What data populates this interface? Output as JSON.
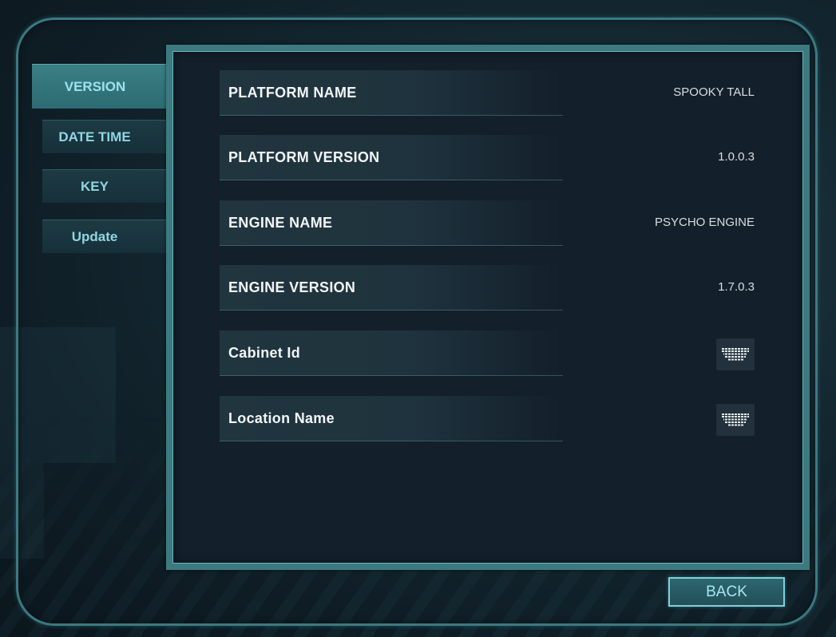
{
  "tabs": [
    {
      "label": "VERSION",
      "active": true
    },
    {
      "label": "DATE TIME",
      "active": false
    },
    {
      "label": "KEY",
      "active": false
    },
    {
      "label": "Update",
      "active": false
    }
  ],
  "rows": [
    {
      "label": "PLATFORM NAME",
      "value": "SPOOKY TALL"
    },
    {
      "label": "PLATFORM VERSION",
      "value": "1.0.0.3"
    },
    {
      "label": "ENGINE NAME",
      "value": "PSYCHO ENGINE"
    },
    {
      "label": "ENGINE VERSION",
      "value": "1.7.0.3"
    },
    {
      "label": "Cabinet Id",
      "icon": "keyboard-icon"
    },
    {
      "label": "Location Name",
      "icon": "keyboard-icon"
    }
  ],
  "back_button": {
    "label": "BACK"
  },
  "colors": {
    "accent": "#3c7a80",
    "tab_text": "#8fd6e2",
    "panel_bg": "#131f2b"
  }
}
